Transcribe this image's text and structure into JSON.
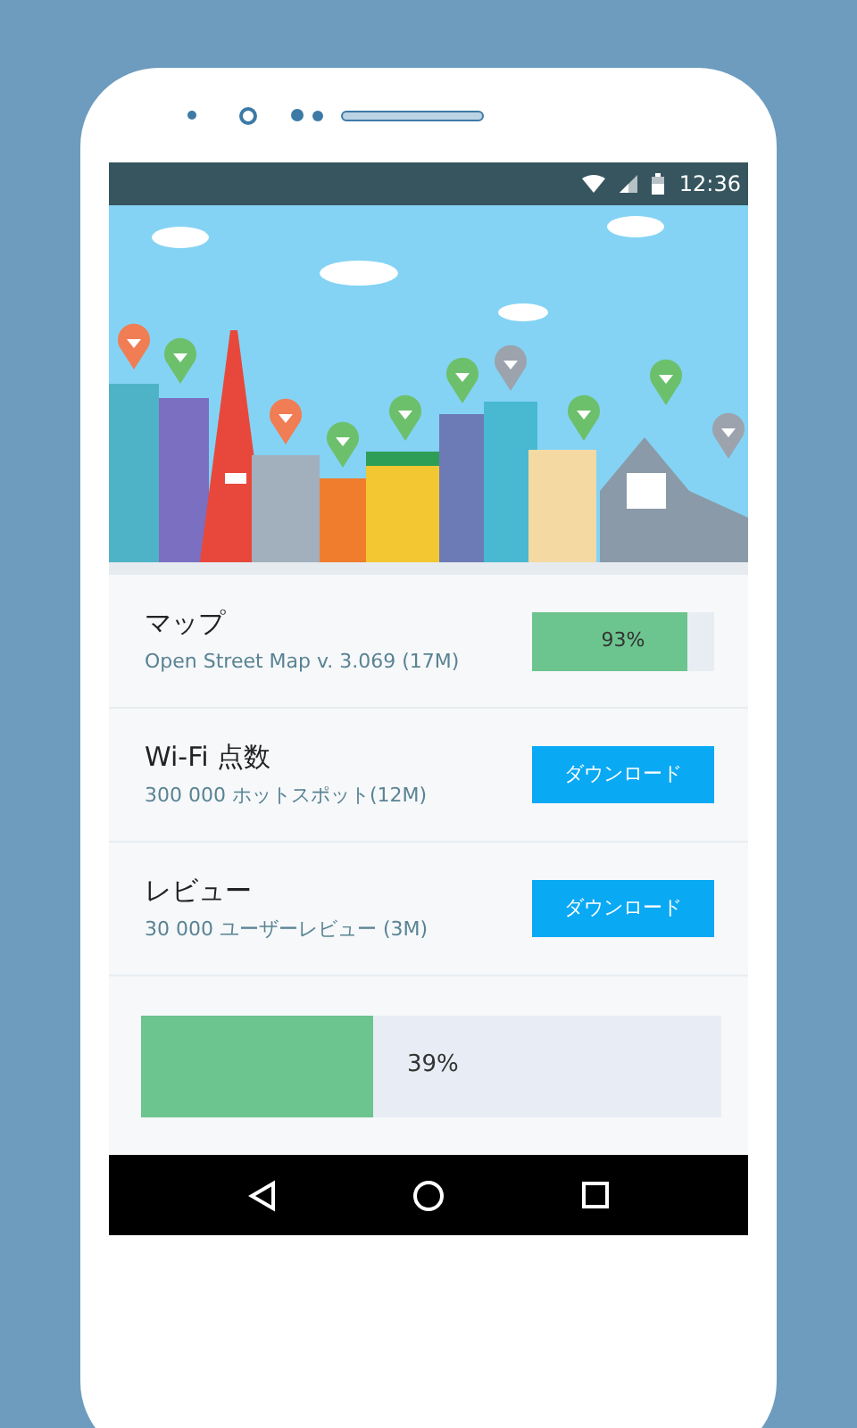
{
  "status_bar": {
    "time": "12:36"
  },
  "items": [
    {
      "kind": "progress",
      "title": "マップ",
      "subtitle": "Open Street Map v. 3.069 (17M)",
      "progress": {
        "label": "93%",
        "level": 0.85
      }
    },
    {
      "kind": "button",
      "title": "Wi-Fi 点数",
      "subtitle": "300 000 ホットスポット(12M)",
      "button": "ダウンロード"
    },
    {
      "kind": "button",
      "title": "レビュー",
      "subtitle": "30 000 ユーザーレビュー (3M)",
      "button": "ダウンロード"
    }
  ],
  "total_progress": {
    "label": "39%",
    "level": 0.4
  }
}
